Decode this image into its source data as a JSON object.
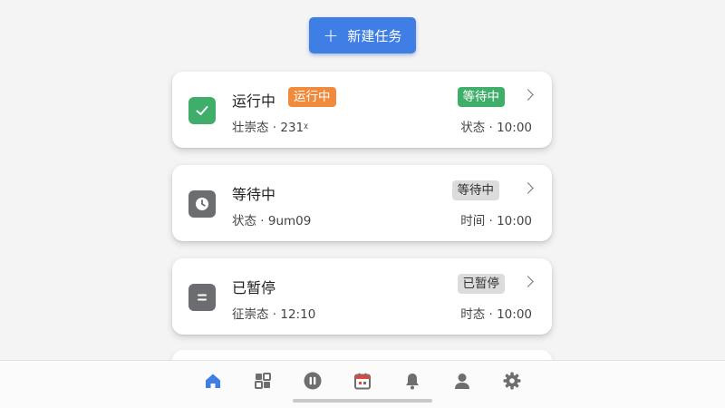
{
  "header": {
    "new_task_label": "新建任务",
    "plus_glyph": "+"
  },
  "tasks": [
    {
      "title": "运行中",
      "inline_badge": "运行中",
      "status_badge": "等待中",
      "subtitle": "壮崇态 · 231ᵡ",
      "time": "状态 · 10:00",
      "icon": "check-icon",
      "icon_color": "#3fae6a",
      "badge_bg": "#3fae6a",
      "badge_fg": "#ffffff"
    },
    {
      "title": "等待中",
      "status_badge": "等待中",
      "subtitle": "状态 · 9um09",
      "time": "时间 · 10:00",
      "icon": "clock-icon",
      "icon_color": "#6b6d70",
      "badge_bg": "#dcdcdc",
      "badge_fg": "#333333"
    },
    {
      "title": "已暂停",
      "status_badge": "已暂停",
      "subtitle": "征崇态 · 12:10",
      "time": "时态 · 10:00",
      "icon": "pause-icon",
      "icon_color": "#6b6d70",
      "badge_bg": "#dcdcdc",
      "badge_fg": "#333333"
    }
  ],
  "nav": {
    "items": [
      "home-icon",
      "grid-icon",
      "pause-circle-icon",
      "calendar-icon",
      "bell-icon",
      "user-icon",
      "gear-icon"
    ],
    "active": "home-icon",
    "active_color": "#3f7ee4",
    "inactive_color": "#6e6e6e"
  }
}
